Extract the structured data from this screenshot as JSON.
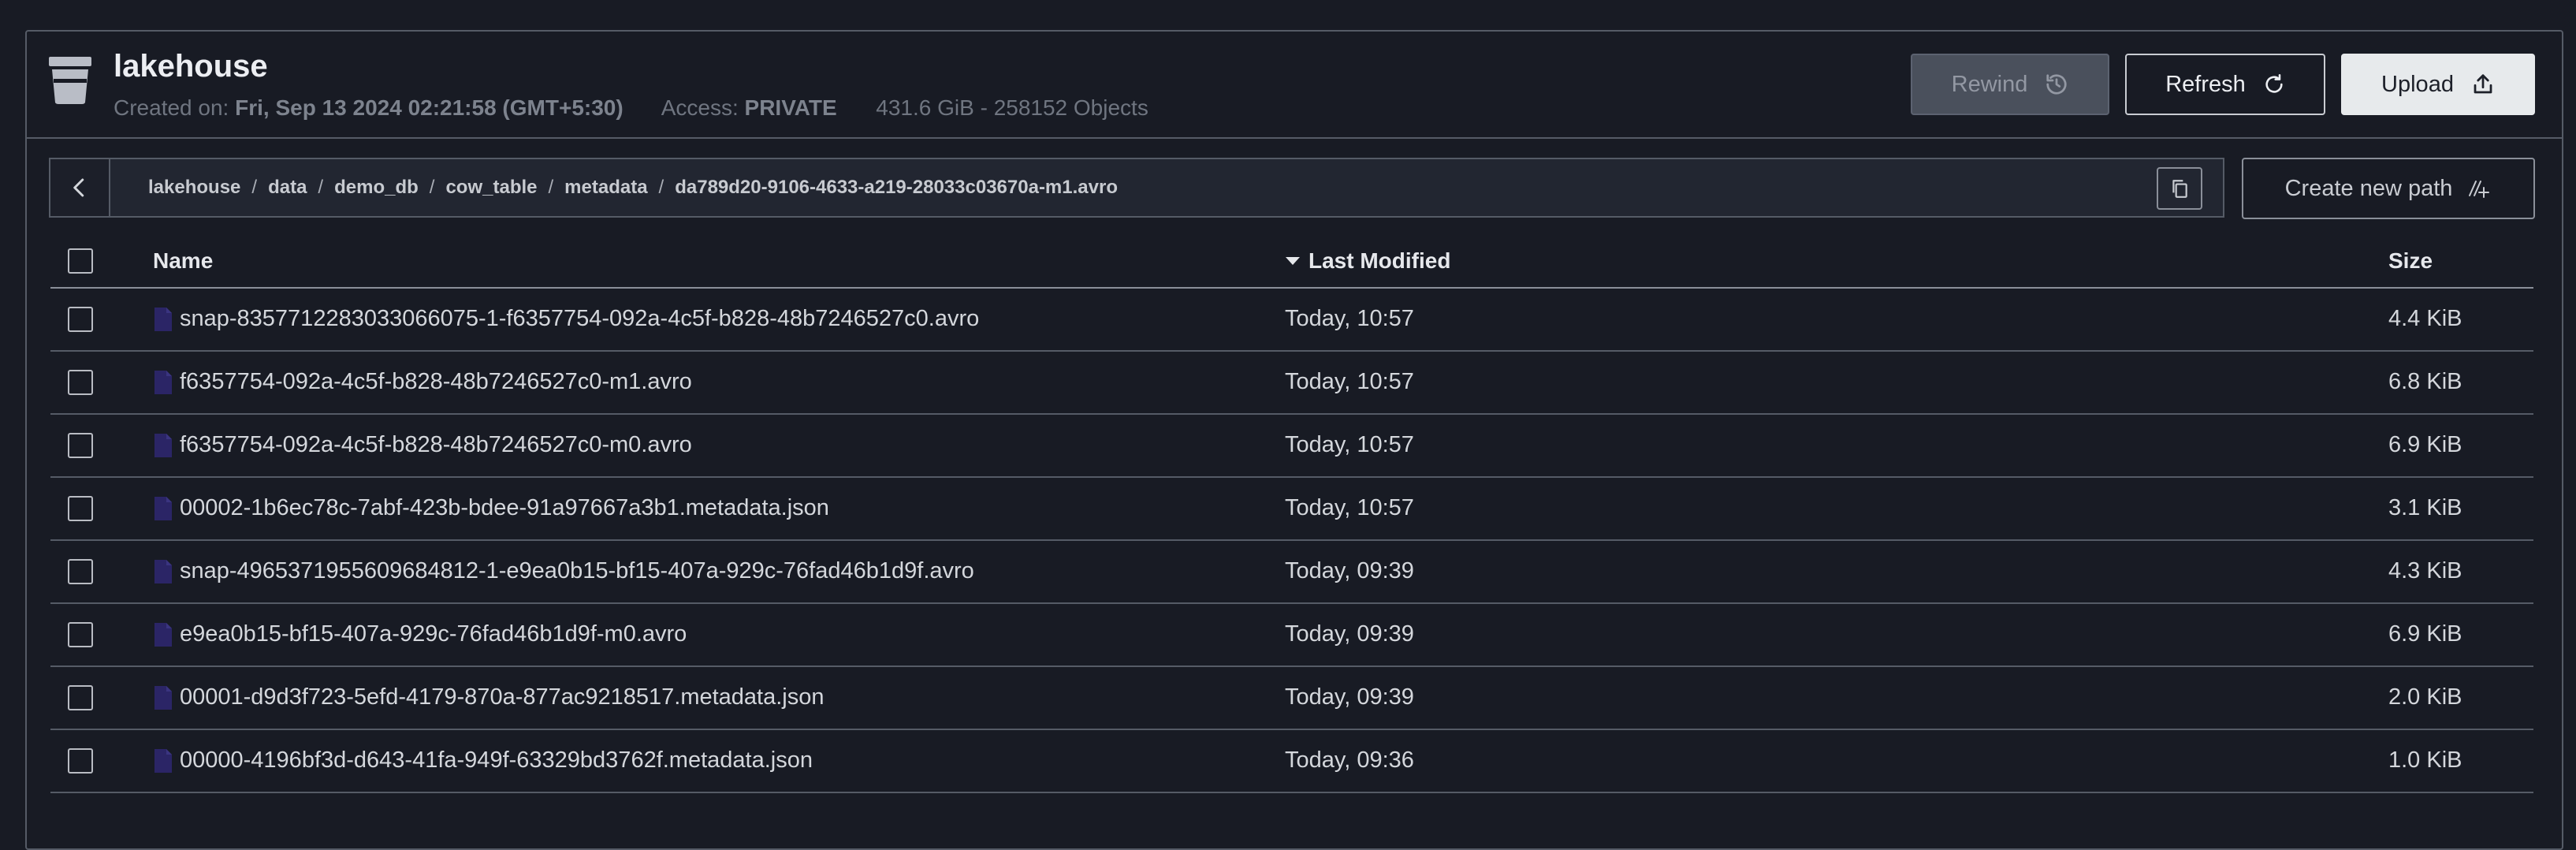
{
  "bucket": {
    "name": "lakehouse",
    "created_label": "Created on:",
    "created_value": "Fri, Sep 13 2024 02:21:58 (GMT+5:30)",
    "access_label": "Access:",
    "access_value": "PRIVATE",
    "usage": "431.6 GiB - 258152 Objects",
    "icon": "bucket-icon"
  },
  "actions": {
    "rewind": "Rewind",
    "refresh": "Refresh",
    "upload": "Upload"
  },
  "path": {
    "segments": [
      "lakehouse",
      "data",
      "demo_db",
      "cow_table",
      "metadata",
      "da789d20-9106-4633-a219-28033c03670a-m1.avro"
    ],
    "separator": "/",
    "create_new_path": "Create new path"
  },
  "table": {
    "headers": {
      "name": "Name",
      "last_modified": "Last Modified",
      "size": "Size"
    },
    "sort": "last_modified-desc",
    "rows": [
      {
        "name": "snap-8357712283033066075-1-f6357754-092a-4c5f-b828-48b7246527c0.avro",
        "modified": "Today, 10:57",
        "size": "4.4 KiB"
      },
      {
        "name": "f6357754-092a-4c5f-b828-48b7246527c0-m1.avro",
        "modified": "Today, 10:57",
        "size": "6.8 KiB"
      },
      {
        "name": "f6357754-092a-4c5f-b828-48b7246527c0-m0.avro",
        "modified": "Today, 10:57",
        "size": "6.9 KiB"
      },
      {
        "name": "00002-1b6ec78c-7abf-423b-bdee-91a97667a3b1.metadata.json",
        "modified": "Today, 10:57",
        "size": "3.1 KiB"
      },
      {
        "name": "snap-4965371955609684812-1-e9ea0b15-bf15-407a-929c-76fad46b1d9f.avro",
        "modified": "Today, 09:39",
        "size": "4.3 KiB"
      },
      {
        "name": "e9ea0b15-bf15-407a-929c-76fad46b1d9f-m0.avro",
        "modified": "Today, 09:39",
        "size": "6.9 KiB"
      },
      {
        "name": "00001-d9d3f723-5efd-4179-870a-877ac9218517.metadata.json",
        "modified": "Today, 09:39",
        "size": "2.0 KiB"
      },
      {
        "name": "00000-4196bf3d-d643-41fa-949f-63329bd3762f.metadata.json",
        "modified": "Today, 09:36",
        "size": "1.0 KiB"
      }
    ]
  },
  "colors": {
    "background": "#181b24",
    "border": "#555b66",
    "file_icon": "#2b2566",
    "upload_bg": "#e7eaec"
  }
}
